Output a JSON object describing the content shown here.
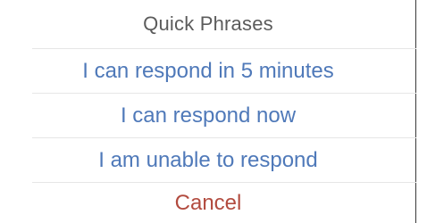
{
  "sheet": {
    "title": "Quick Phrases",
    "options": [
      {
        "label": "I can respond in 5 minutes"
      },
      {
        "label": "I can respond now"
      },
      {
        "label": "I am unable to respond"
      }
    ],
    "cancel_label": "Cancel"
  },
  "colors": {
    "title_text": "#5b5b5b",
    "option_text": "#4f79b9",
    "cancel_text": "#b24b3f",
    "separator": "#e6e6e6",
    "background": "#ffffff"
  }
}
